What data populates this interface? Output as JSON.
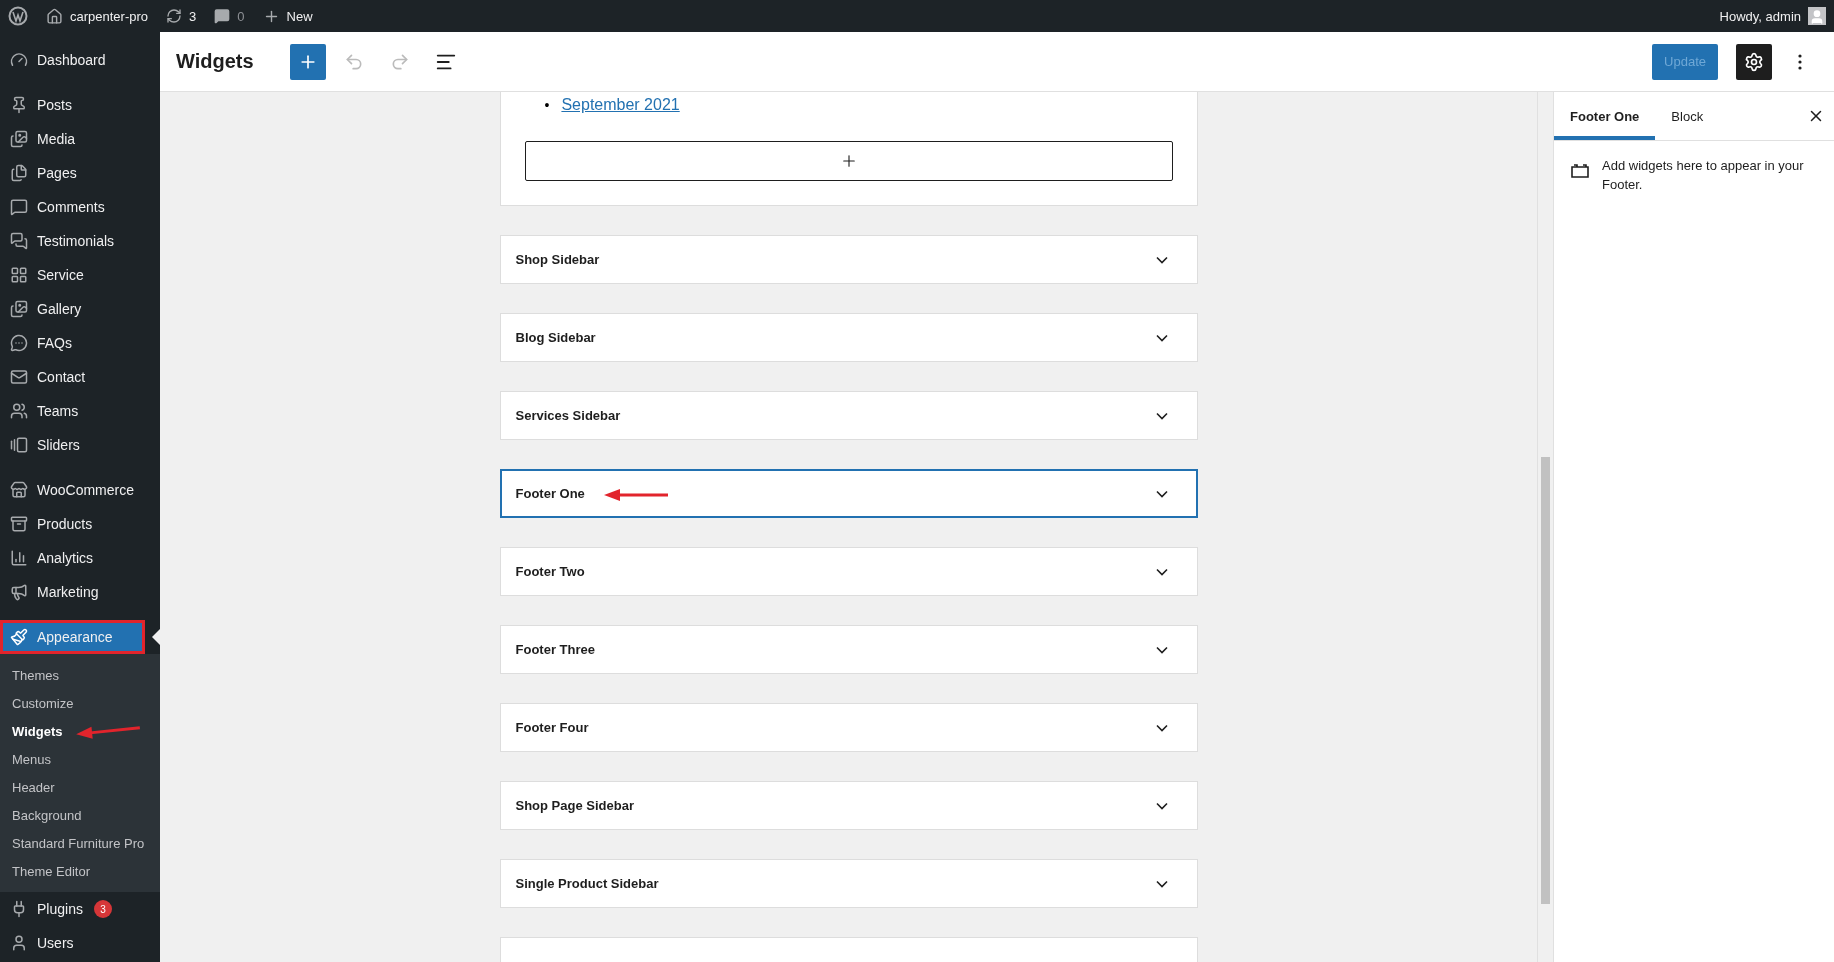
{
  "admin_bar": {
    "site_name": "carpenter-pro",
    "updates": "3",
    "comments": "0",
    "new_label": "New",
    "greeting": "Howdy, admin"
  },
  "sidebar": {
    "groups": [
      [
        {
          "label": "Dashboard",
          "selected": false
        }
      ],
      [
        {
          "label": "Posts",
          "selected": false
        },
        {
          "label": "Media",
          "selected": false
        },
        {
          "label": "Pages",
          "selected": false
        },
        {
          "label": "Comments",
          "selected": false
        },
        {
          "label": "Testimonials",
          "selected": false
        },
        {
          "label": "Service",
          "selected": false
        },
        {
          "label": "Gallery",
          "selected": false
        },
        {
          "label": "FAQs",
          "selected": false
        },
        {
          "label": "Contact",
          "selected": false
        },
        {
          "label": "Teams",
          "selected": false
        },
        {
          "label": "Sliders",
          "selected": false
        }
      ],
      [
        {
          "label": "WooCommerce",
          "selected": false
        },
        {
          "label": "Products",
          "selected": false
        },
        {
          "label": "Analytics",
          "selected": false
        },
        {
          "label": "Marketing",
          "selected": false
        }
      ],
      [
        {
          "label": "Appearance",
          "selected": true,
          "annotated": true,
          "submenu": [
            {
              "label": "Themes",
              "selected": false,
              "annotated": false
            },
            {
              "label": "Customize",
              "selected": false,
              "annotated": false
            },
            {
              "label": "Widgets",
              "selected": true,
              "annotated": true
            },
            {
              "label": "Menus",
              "selected": false,
              "annotated": false
            },
            {
              "label": "Header",
              "selected": false,
              "annotated": false
            },
            {
              "label": "Background",
              "selected": false,
              "annotated": false
            },
            {
              "label": "Standard Furniture Pro",
              "selected": false,
              "annotated": false
            },
            {
              "label": "Theme Editor",
              "selected": false,
              "annotated": false
            }
          ]
        },
        {
          "label": "Plugins",
          "selected": false,
          "badge": "3"
        },
        {
          "label": "Users",
          "selected": false
        }
      ]
    ]
  },
  "header": {
    "title": "Widgets",
    "update_label": "Update",
    "update_disabled": true,
    "settings_on": true
  },
  "editor": {
    "archive_links": [
      {
        "marker": "•",
        "label": "September 2021"
      }
    ],
    "areas": [
      {
        "title": "Shop Sidebar",
        "selected": false,
        "annotated": false
      },
      {
        "title": "Blog Sidebar",
        "selected": false,
        "annotated": false
      },
      {
        "title": "Services Sidebar",
        "selected": false,
        "annotated": false
      },
      {
        "title": "Footer One",
        "selected": true,
        "annotated": true
      },
      {
        "title": "Footer Two",
        "selected": false,
        "annotated": false
      },
      {
        "title": "Footer Three",
        "selected": false,
        "annotated": false
      },
      {
        "title": "Footer Four",
        "selected": false,
        "annotated": false
      },
      {
        "title": "Shop Page Sidebar",
        "selected": false,
        "annotated": false
      },
      {
        "title": "Single Product Sidebar",
        "selected": false,
        "annotated": false
      },
      {
        "selected": false,
        "annotated": false
      }
    ]
  },
  "settings_panel": {
    "tabs": [
      {
        "label": "Footer One",
        "selected": true
      },
      {
        "label": "Block",
        "selected": false
      }
    ],
    "description": "Add widgets here to appear in your Footer."
  }
}
